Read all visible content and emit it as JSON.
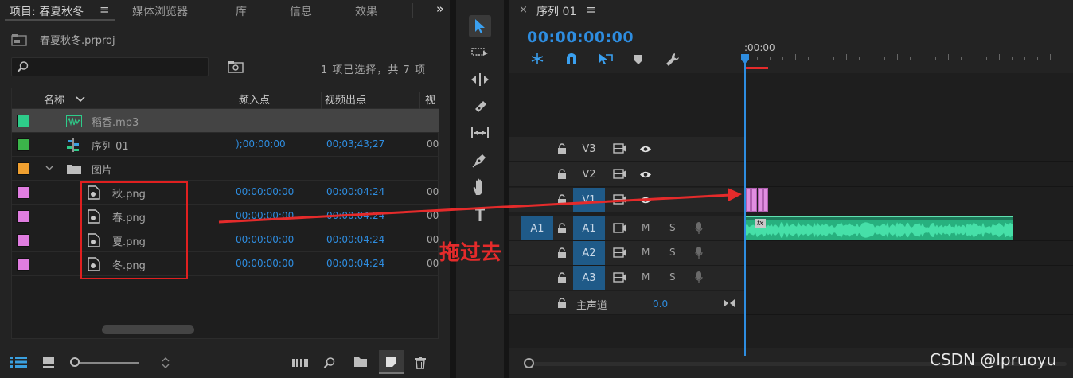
{
  "project_panel": {
    "tabs": [
      {
        "label": "项目: 春夏秋冬",
        "active": true
      },
      {
        "label": "媒体浏览器"
      },
      {
        "label": "库"
      },
      {
        "label": "信息"
      },
      {
        "label": "效果"
      }
    ],
    "more_tabs_glyph": "»",
    "project_file": "春夏秋冬.prproj",
    "search_placeholder": "",
    "selection_count": "1 项已选择，共 7 项",
    "columns": [
      "名称",
      "频入点",
      "视频出点",
      "视"
    ],
    "rows": [
      {
        "name": "稻香.mp3",
        "color": "#2ecc8a",
        "icon": "audio-icon",
        "in": "",
        "out": "",
        "extra": "",
        "selected": true
      },
      {
        "name": "序列 01",
        "color": "#3bb54a",
        "icon": "sequence-icon",
        "in": ");00;00;00",
        "out": "00;03;43;27",
        "extra": "00"
      },
      {
        "name": "图片",
        "color": "#f0a030",
        "icon": "folder-icon",
        "in": "",
        "out": "",
        "extra": "",
        "expanded": true
      },
      {
        "name": "秋.png",
        "color": "#e07de0",
        "icon": "image-file-icon",
        "in": "00:00:00:00",
        "out": "00:00:04:24",
        "extra": "00"
      },
      {
        "name": "春.png",
        "color": "#e07de0",
        "icon": "image-file-icon",
        "in": "00:00:00:00",
        "out": "00:00:04:24",
        "extra": "00"
      },
      {
        "name": "夏.png",
        "color": "#e07de0",
        "icon": "image-file-icon",
        "in": "00:00:00:00",
        "out": "00:00:04:24",
        "extra": "00"
      },
      {
        "name": "冬.png",
        "color": "#e07de0",
        "icon": "image-file-icon",
        "in": "00:00:00:00",
        "out": "00:00:04:24",
        "extra": "00"
      }
    ]
  },
  "timeline_panel": {
    "title": "序列 01",
    "timecode": "00:00:00:00",
    "ruler_label": ":00:00",
    "tracks": {
      "V3": "V3",
      "V2": "V2",
      "V1": "V1",
      "A1_source": "A1",
      "A1": "A1",
      "A2": "A2",
      "A3": "A3",
      "mute": "M",
      "solo": "S"
    },
    "master_label": "主声道",
    "master_value": "0.0",
    "fx_badge": "fx"
  },
  "annotation": {
    "drag_note": "拖过去",
    "arrow_color": "#e52b2b"
  },
  "watermark": "CSDN @lpruoyu"
}
